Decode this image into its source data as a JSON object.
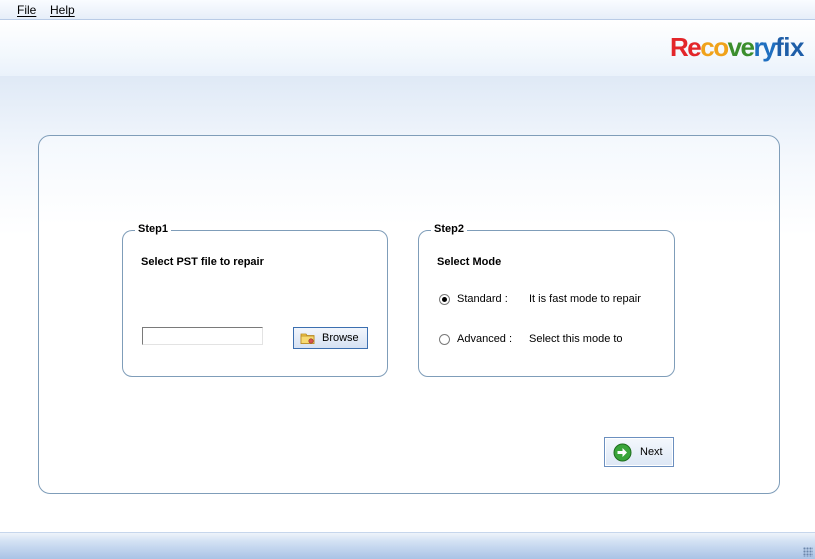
{
  "menu": {
    "file": "File",
    "help": "Help"
  },
  "logo": {
    "part1": "Re",
    "part2": "co",
    "part3": "ve",
    "part4": "ry",
    "part5": "fix"
  },
  "step1": {
    "legend": "Step1",
    "title": "Select PST file to repair",
    "path_value": "",
    "browse_label": "Browse"
  },
  "step2": {
    "legend": "Step2",
    "title": "Select Mode",
    "options": [
      {
        "label": "Standard :",
        "description": "It is fast mode to repair",
        "selected": true
      },
      {
        "label": "Advanced :",
        "description": "Select this mode to",
        "selected": false
      }
    ]
  },
  "next_label": "Next",
  "colors": {
    "accent_border": "#7f9db9",
    "next_icon": "#3aa53a",
    "status_bar": "#a9c3e6"
  },
  "icons": {
    "browse": "folder-icon",
    "next": "next-arrow-icon",
    "grip": "resize-grip-icon"
  }
}
